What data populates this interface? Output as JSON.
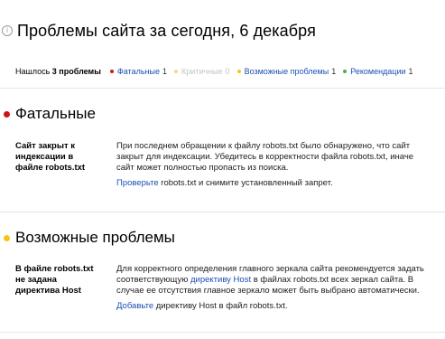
{
  "header": {
    "icon": "info-icon",
    "title": "Проблемы сайта за сегодня, 6 декабря"
  },
  "summary": {
    "found_prefix": "Нашлось",
    "found_count": "3 проблемы",
    "categories": [
      {
        "label": "Фатальные",
        "count": "1",
        "color": "#d01818",
        "enabled": true
      },
      {
        "label": "Критичные",
        "count": "0",
        "color": "#f5a623",
        "enabled": false
      },
      {
        "label": "Возможные проблемы",
        "count": "1",
        "color": "#f5c518",
        "enabled": true
      },
      {
        "label": "Рекомендации",
        "count": "1",
        "color": "#4caf50",
        "enabled": true
      }
    ]
  },
  "sections": [
    {
      "title": "Фатальные",
      "color": "#c81414",
      "issue": {
        "title": "Сайт закрыт к индексации в файле robots.txt",
        "description": "При последнем обращении к файлу robots.txt было обнаружено, что сайт закрыт для индексации. Убедитесь в корректности файла robots.txt, иначе сайт может полностью пропасть из поиска.",
        "action_link": "Проверьте",
        "action_rest": "robots.txt и снимите установленный запрет."
      }
    },
    {
      "title": "Возможные проблемы",
      "color": "#f5c518",
      "issue": {
        "title": "В файле robots.txt не задана директива Host",
        "desc_part1": "Для корректного определения главного зеркала сайта рекомендуется задать соответствующую",
        "desc_link": "директиву Host",
        "desc_part2": "в файлах robots.txt всех зеркал сайта. В случае ее отсутствия главное зеркало может быть выбрано автоматически.",
        "action_link": "Добавьте",
        "action_rest": "директиву Host в файл robots.txt."
      }
    }
  ]
}
